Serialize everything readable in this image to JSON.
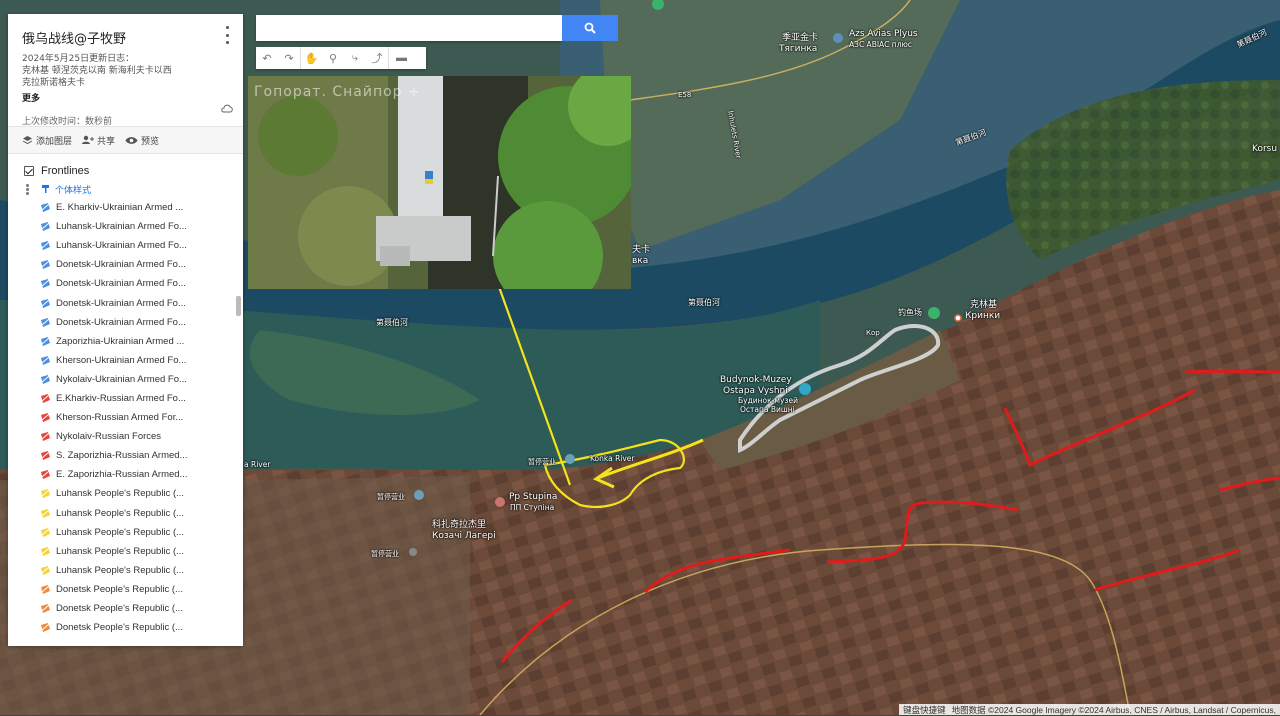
{
  "panel": {
    "title": "俄乌战线@子牧野",
    "desc_line1": "2024年5月25日更新日志：",
    "desc_line2": "克林基 顿涅茨克以南 新海利夫卡以西",
    "desc_line3": "克拉斯诺格夫卡",
    "more": "更多",
    "modified": "上次修改时间：数秒前",
    "add_layer": "添加图层",
    "share": "共享",
    "preview": "预览",
    "layer_title": "Frontlines",
    "style_label": "个体样式",
    "items": [
      {
        "label": "E. Kharkiv-Ukrainian Armed ...",
        "color": "#4a90e2"
      },
      {
        "label": "Luhansk-Ukrainian Armed Fo...",
        "color": "#4a90e2"
      },
      {
        "label": "Luhansk-Ukrainian Armed Fo...",
        "color": "#4a90e2"
      },
      {
        "label": "Donetsk-Ukrainian Armed Fo...",
        "color": "#4a90e2"
      },
      {
        "label": "Donetsk-Ukrainian Armed Fo...",
        "color": "#4a90e2"
      },
      {
        "label": "Donetsk-Ukrainian Armed Fo...",
        "color": "#4a90e2"
      },
      {
        "label": "Donetsk-Ukrainian Armed Fo...",
        "color": "#4a90e2"
      },
      {
        "label": "Zaporizhia-Ukrainian Armed ...",
        "color": "#4a90e2"
      },
      {
        "label": "Kherson-Ukrainian Armed Fo...",
        "color": "#4a90e2"
      },
      {
        "label": "Nykolaiv-Ukrainian Armed Fo...",
        "color": "#4a90e2"
      },
      {
        "label": "E.Kharkiv-Russian Armed Fo...",
        "color": "#e8453c"
      },
      {
        "label": "Kherson-Russian Armed For...",
        "color": "#e8453c"
      },
      {
        "label": "Nykolaiv-Russian Forces",
        "color": "#e8453c"
      },
      {
        "label": "S. Zaporizhia-Russian Armed...",
        "color": "#e8453c"
      },
      {
        "label": "E. Zaporizhia-Russian Armed...",
        "color": "#e8453c"
      },
      {
        "label": "Luhansk People's Republic (...",
        "color": "#f2d338"
      },
      {
        "label": "Luhansk People's Republic (...",
        "color": "#f2d338"
      },
      {
        "label": "Luhansk People's Republic (...",
        "color": "#f2d338"
      },
      {
        "label": "Luhansk People's Republic (...",
        "color": "#f2d338"
      },
      {
        "label": "Luhansk People's Republic (...",
        "color": "#f2d338"
      },
      {
        "label": "Donetsk People's Republic (...",
        "color": "#f08a3c"
      },
      {
        "label": "Donetsk People's Republic (...",
        "color": "#f08a3c"
      },
      {
        "label": "Donetsk People's Republic (...",
        "color": "#f08a3c"
      }
    ]
  },
  "search": {
    "placeholder": ""
  },
  "photo": {
    "caption": "Гопорат. Снайпор +"
  },
  "map_labels": {
    "azs": "Azs Avias Plyus",
    "azs2": "АЗС АВІАС плюс",
    "tyahynka1": "季亚金卡",
    "tyahynka2": "Тягинка",
    "road": "E58",
    "river_ingulets": "Inhulets River",
    "river_dnipro1": "第聂伯河",
    "river_dnipro2": "第聂伯河",
    "river_dnipro3": "第聂伯河",
    "river_top": "第聂伯河",
    "korsu": "Korsu",
    "krynky_cn": "克林基",
    "krynky_ua": "Кринки",
    "fishing": "钓鱼场",
    "budynok1": "Budynok-Muzey",
    "budynok2": "Ostapa Vyshni",
    "budynok3": "Будинок-музей",
    "budynok4": "Остапа Вишні",
    "closed1": "暂停营业",
    "closed2": "暂停营业",
    "closed3": "暂停营业",
    "stupina1": "Pp Stupina",
    "stupina2": "ПП Ступіна",
    "kozachi_cn": "科扎奇拉杰里",
    "kozachi_ua": "Козачі Лагері",
    "konka": "Konka River",
    "kvka": "夫卡",
    "kvka2": "вка",
    "river_left": "a River",
    "kor": "Кор"
  },
  "attribution": {
    "shortcuts": "键盘快捷键",
    "data": "地图数据 ©2024 Google Imagery ©2024 Airbus, CNES / Airbus, Landsat / Copernicus,"
  },
  "colors": {
    "frontline": "#e01b1b",
    "arrow": "#f4e21a",
    "highlight": "#c9c9c9",
    "water": "#1d4a63"
  }
}
